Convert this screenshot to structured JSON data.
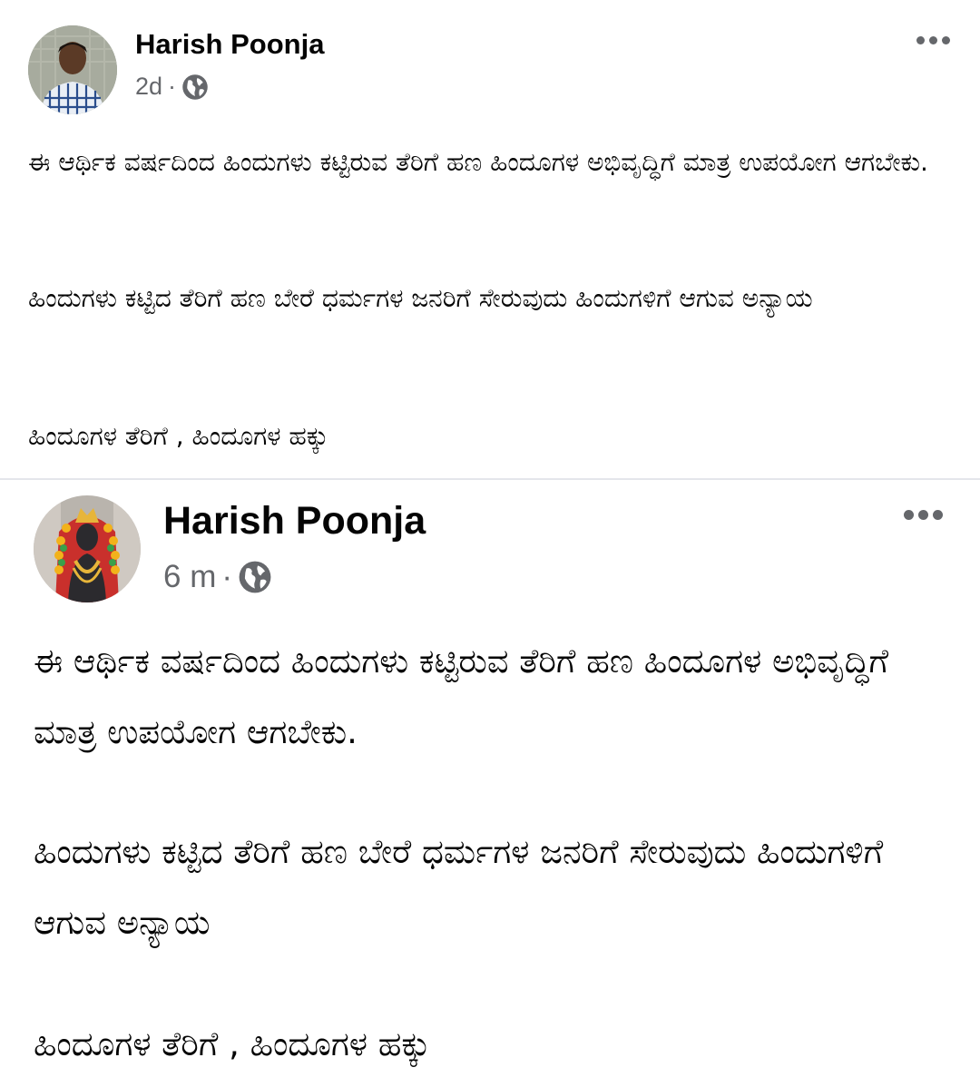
{
  "posts": [
    {
      "author": "Harish Poonja",
      "time": "2d",
      "separator": "·",
      "privacy_icon": "globe-icon",
      "more_icon": "more-options-icon",
      "paragraphs": [
        "ಈ ಆರ್ಥಿಕ ವರ್ಷದಿಂದ ಹಿಂದುಗಳು ಕಟ್ಟಿರುವ ತೆರಿಗೆ ಹಣ ಹಿಂದೂಗಳ ಅಭಿವೃದ್ಧಿಗೆ ಮಾತ್ರ ಉಪಯೋಗ ಆಗಬೇಕು.",
        "ಹಿಂದುಗಳು ಕಟ್ಟಿದ ತೆರಿಗೆ ಹಣ ಬೇರೆ ಧರ್ಮಗಳ ಜನರಿಗೆ ಸೇರುವುದು ಹಿಂದುಗಳಿಗೆ ಆಗುವ ಅನ್ಯಾಯ",
        "ಹಿಂದೂಗಳ ತೆರಿಗೆ , ಹಿಂದೂಗಳ ಹಕ್ಕು"
      ]
    },
    {
      "author": "Harish Poonja",
      "time": "6 m",
      "separator": "·",
      "privacy_icon": "globe-icon",
      "more_icon": "more-options-icon",
      "paragraphs": [
        "ಈ ಆರ್ಥಿಕ ವರ್ಷದಿಂದ ಹಿಂದುಗಳು ಕಟ್ಟಿರುವ ತೆರಿಗೆ ಹಣ ಹಿಂದೂಗಳ ಅಭಿವೃದ್ಧಿಗೆ ಮಾತ್ರ ಉಪಯೋಗ ಆಗಬೇಕು.",
        "ಹಿಂದುಗಳು ಕಟ್ಟಿದ ತೆರಿಗೆ ಹಣ ಬೇರೆ ಧರ್ಮಗಳ ಜನರಿಗೆ ಸೇರುವುದು ಹಿಂದುಗಳಿಗೆ ಆಗುವ ಅನ್ಯಾಯ",
        "ಹಿಂದೂಗಳ ತೆರಿಗೆ , ಹಿಂದೂಗಳ ಹಕ್ಕು"
      ]
    }
  ],
  "colors": {
    "text": "#050505",
    "secondary": "#65676b",
    "divider": "#e4e6eb",
    "background": "#ffffff"
  }
}
